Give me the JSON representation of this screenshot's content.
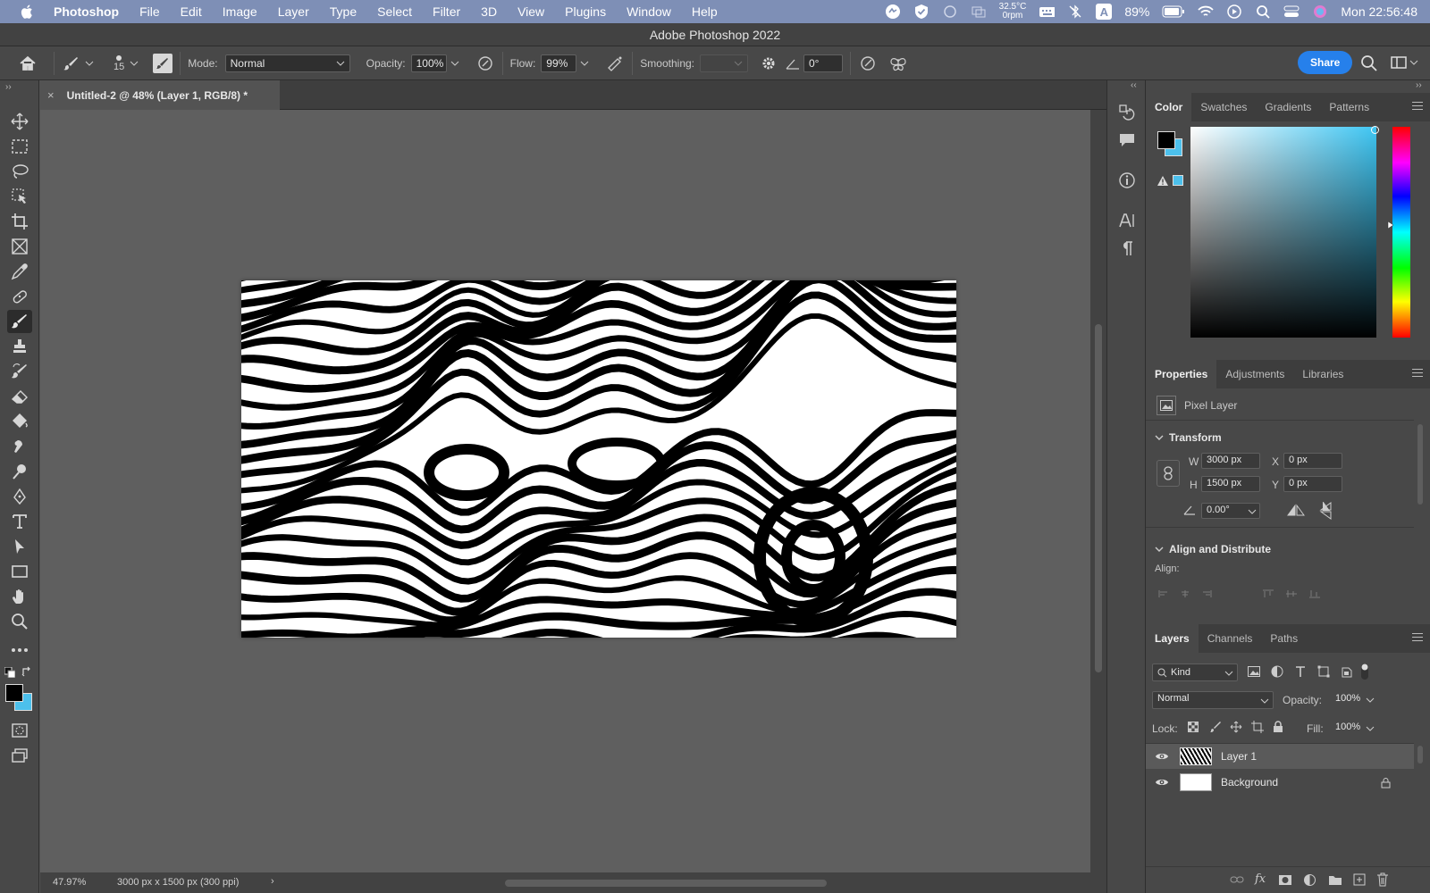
{
  "menubar": {
    "app": "Photoshop",
    "items": [
      "File",
      "Edit",
      "Image",
      "Layer",
      "Type",
      "Select",
      "Filter",
      "3D",
      "View",
      "Plugins",
      "Window",
      "Help"
    ],
    "temp": "32.5°C",
    "rpm": "0rpm",
    "battery": "89%",
    "input_letter": "A",
    "clock": "Mon  22:56:48"
  },
  "window_title": "Adobe Photoshop 2022",
  "options": {
    "brush_size": "15",
    "mode_label": "Mode:",
    "mode_value": "Normal",
    "opacity_label": "Opacity:",
    "opacity_value": "100%",
    "flow_label": "Flow:",
    "flow_value": "99%",
    "smoothing_label": "Smoothing:",
    "smoothing_value": "",
    "angle_value": "0°",
    "share": "Share"
  },
  "document": {
    "tab_title": "Untitled-2 @ 48% (Layer 1, RGB/8) *",
    "zoom": "47.97%",
    "doc_info": "3000 px x 1500 px (300 ppi)"
  },
  "color_panel": {
    "tabs": [
      "Color",
      "Swatches",
      "Gradients",
      "Patterns"
    ],
    "active_tab": "Color",
    "foreground": "#000000",
    "background": "#4cc0ec"
  },
  "properties": {
    "tabs": [
      "Properties",
      "Adjustments",
      "Libraries"
    ],
    "layer_kind": "Pixel Layer",
    "transform_title": "Transform",
    "w_label": "W",
    "w": "3000 px",
    "h_label": "H",
    "h": "1500 px",
    "x_label": "X",
    "x": "0 px",
    "y_label": "Y",
    "y": "0 px",
    "angle": "0.00°",
    "align_title": "Align and Distribute",
    "align_label": "Align:"
  },
  "layers_panel": {
    "tabs": [
      "Layers",
      "Channels",
      "Paths"
    ],
    "filter_kind": "Kind",
    "blend_mode": "Normal",
    "opacity_label": "Opacity:",
    "opacity": "100%",
    "lock_label": "Lock:",
    "fill_label": "Fill:",
    "fill": "100%",
    "layers": [
      {
        "name": "Layer 1",
        "selected": true,
        "locked": false
      },
      {
        "name": "Background",
        "selected": false,
        "locked": true
      }
    ]
  }
}
